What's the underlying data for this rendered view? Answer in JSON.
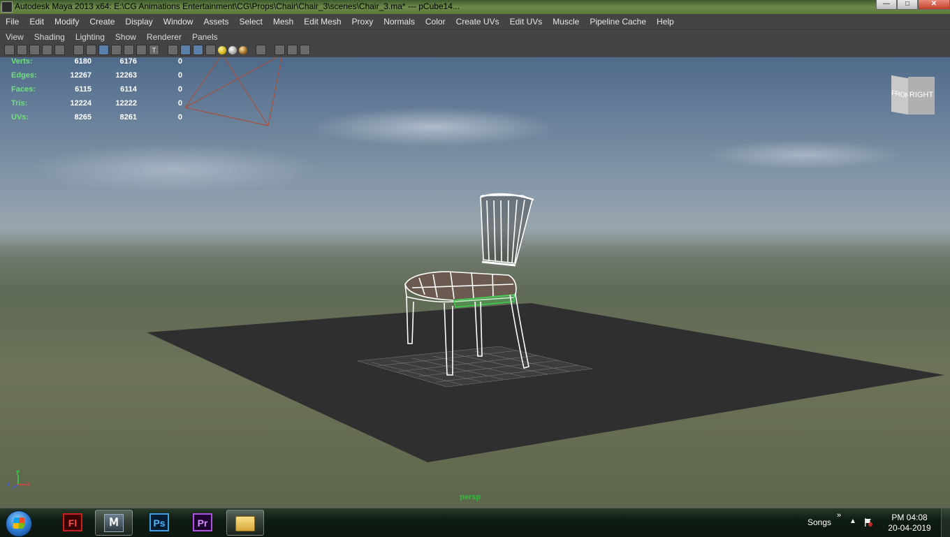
{
  "window": {
    "title": "Autodesk Maya 2013 x64: E:\\CG Animations Entertainment\\CG\\Props\\Chair\\Chair_3\\scenes\\Chair_3.ma*   ---   pCube14...",
    "min_label": "—",
    "max_label": "□",
    "close_label": "✕"
  },
  "main_menu": [
    "File",
    "Edit",
    "Modify",
    "Create",
    "Display",
    "Window",
    "Assets",
    "Select",
    "Mesh",
    "Edit Mesh",
    "Proxy",
    "Normals",
    "Color",
    "Create UVs",
    "Edit UVs",
    "Muscle",
    "Pipeline Cache",
    "Help"
  ],
  "panel_menu": [
    "View",
    "Shading",
    "Lighting",
    "Show",
    "Renderer",
    "Panels"
  ],
  "toolbar_icons": [
    "camera-attr-icon",
    "camera-select-icon",
    "bookmark-icon",
    "image-plane-icon",
    "2d-pan-icon",
    "grid-icon",
    "film-gate-icon",
    "resolution-gate-icon",
    "gate-mask-icon",
    "safe-title-icon",
    "wireframe-icon",
    "smooth-shade-icon",
    "wireframe-on-shaded-icon",
    "textured-icon",
    "use-all-lights-icon",
    "shadows-icon",
    "ambient-occlusion-icon",
    "isolate-select-icon",
    "xray-icon",
    "xray-joints-icon",
    "hud-icon"
  ],
  "hud": {
    "rows": [
      {
        "label": "Verts:",
        "v1": "6180",
        "v2": "6176",
        "v3": "0"
      },
      {
        "label": "Edges:",
        "v1": "12267",
        "v2": "12263",
        "v3": "0"
      },
      {
        "label": "Faces:",
        "v1": "6115",
        "v2": "6114",
        "v3": "0"
      },
      {
        "label": "Tris:",
        "v1": "12224",
        "v2": "12222",
        "v3": "0"
      },
      {
        "label": "UVs:",
        "v1": "8265",
        "v2": "8261",
        "v3": "0"
      }
    ]
  },
  "viewcube": {
    "front": "FRONT",
    "right": "RIGHT"
  },
  "viewport": {
    "camera_label": "persp"
  },
  "axis": {
    "x": "x",
    "y": "y",
    "z": "z"
  },
  "taskbar": {
    "apps": [
      {
        "name": "flash",
        "label": "Fl"
      },
      {
        "name": "maya",
        "label": "Ⅿ"
      },
      {
        "name": "photoshop",
        "label": "Ps"
      },
      {
        "name": "premiere",
        "label": "Pr"
      },
      {
        "name": "explorer",
        "label": ""
      }
    ],
    "tray_label": "Songs",
    "tray_chevron": "»",
    "tray_up": "▲",
    "time": "PM 04:08",
    "date": "20-04-2019"
  },
  "colors": {
    "hud_label": "#6fe07a",
    "persp_label": "#2fbd3b",
    "ground": "#2f2f2f",
    "wire": "#ffffff",
    "selected_wire": "#3ad04a"
  }
}
